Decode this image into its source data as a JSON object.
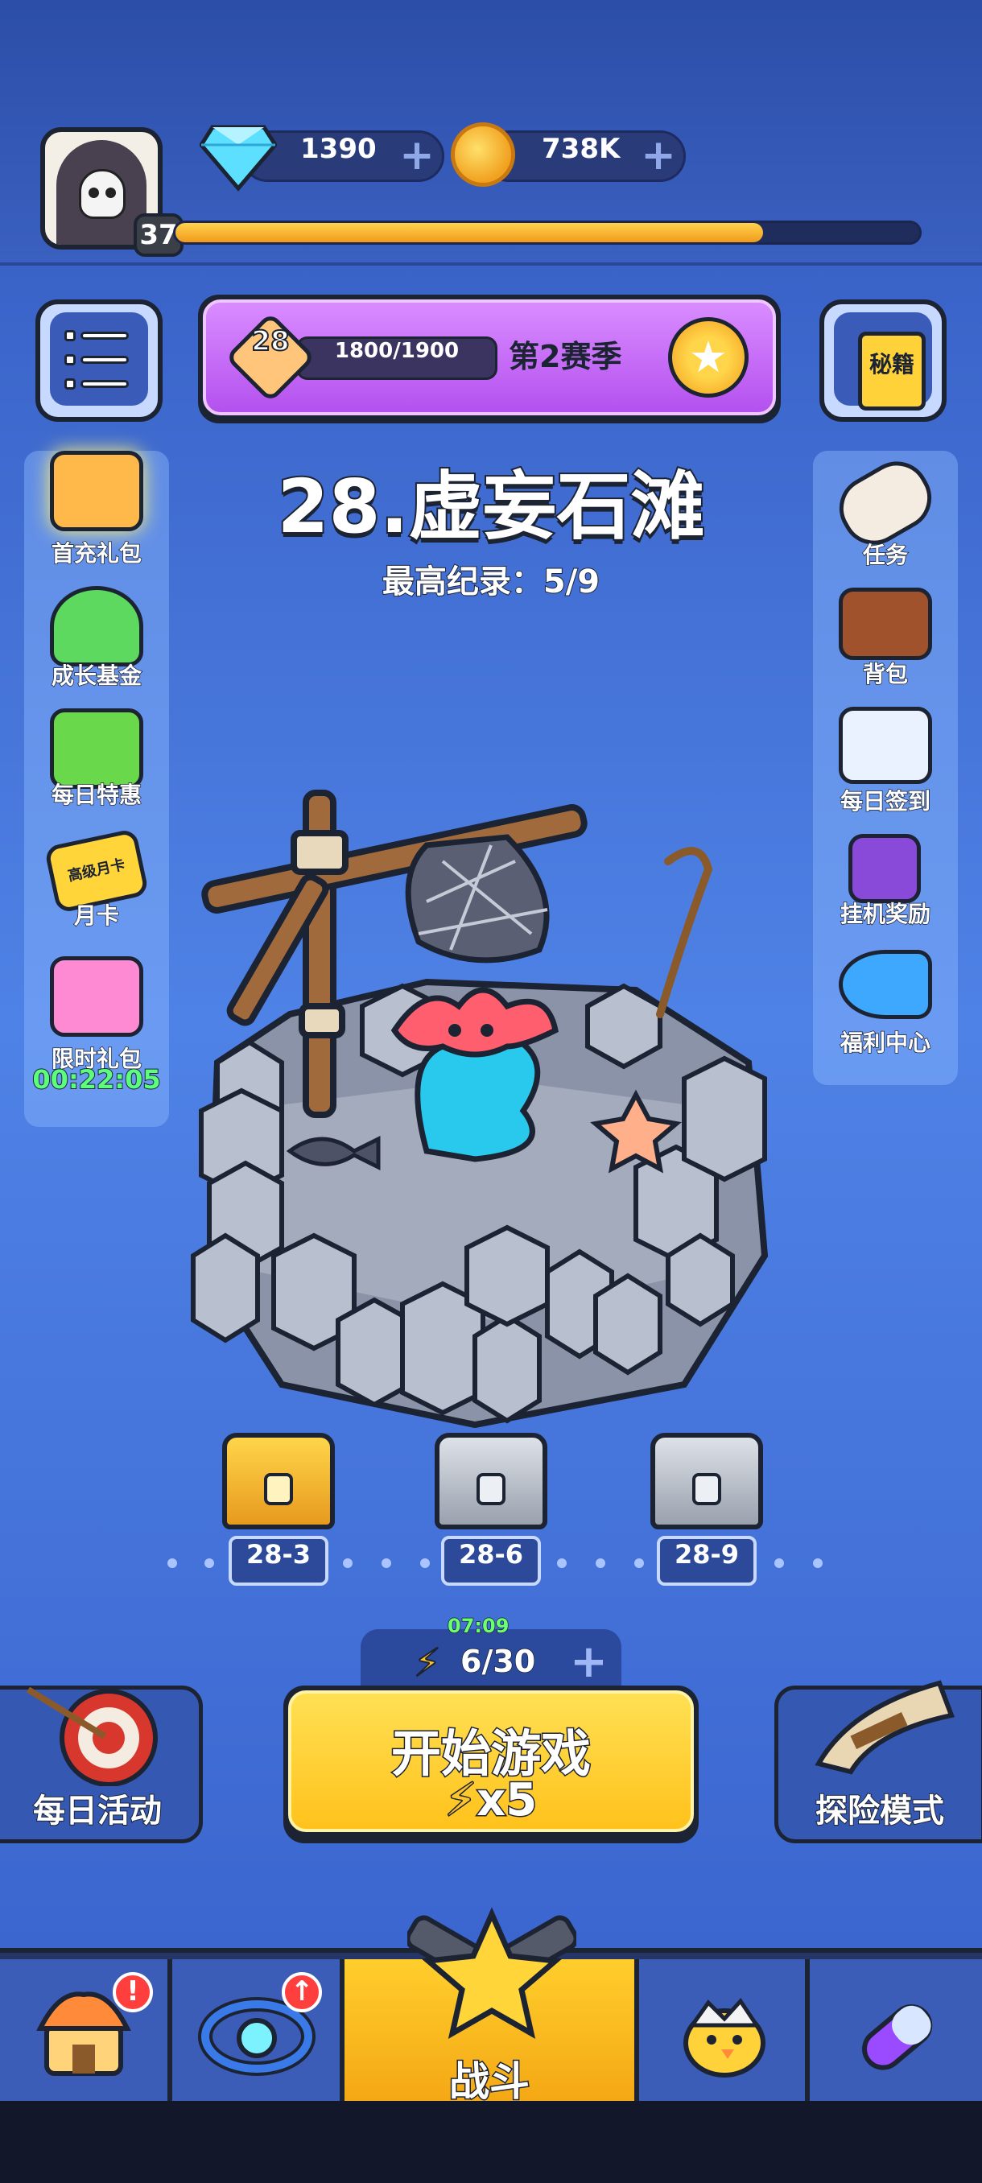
{
  "player": {
    "level": "37",
    "xp_fraction": 0.79
  },
  "currency": {
    "gems": "1390",
    "coins": "738K",
    "plus": "+"
  },
  "season": {
    "level": "28",
    "progress": "1800/1900",
    "title": "第2赛季"
  },
  "secret_button": {
    "label": "秘籍"
  },
  "stage": {
    "title": "28.虚妄石滩",
    "record": "最高纪录：5/9"
  },
  "left_side": [
    {
      "label": "首充礼包",
      "icon": "gift-chest-icon"
    },
    {
      "label": "成长基金",
      "icon": "growth-arrow-icon"
    },
    {
      "label": "每日特惠",
      "icon": "shopping-basket-icon"
    },
    {
      "label": "月卡",
      "icon": "monthly-card-icon",
      "card_text": "高级月卡"
    },
    {
      "label": "限时礼包",
      "icon": "limited-gift-icon",
      "timer": "00:22:05"
    }
  ],
  "right_side": [
    {
      "label": "任务",
      "icon": "scroll-icon"
    },
    {
      "label": "背包",
      "icon": "backpack-icon"
    },
    {
      "label": "每日签到",
      "icon": "clipboard-check-icon"
    },
    {
      "label": "挂机奖励",
      "icon": "hourglass-icon"
    },
    {
      "label": "福利中心",
      "icon": "megaphone-icon"
    }
  ],
  "chests": [
    {
      "label": "28-3",
      "state": "gold"
    },
    {
      "label": "28-6",
      "state": "locked"
    },
    {
      "label": "28-9",
      "state": "locked"
    }
  ],
  "energy": {
    "timer": "07:09",
    "value": "6/30",
    "bolt": "⚡",
    "plus": "+"
  },
  "start": {
    "label": "开始游戏",
    "cost": "x5",
    "bolt": "⚡"
  },
  "modes": {
    "left": "每日活动",
    "right": "探险模式"
  },
  "nav": {
    "battle_label": "战斗",
    "badge_alert": "!",
    "badge_up": "↑"
  },
  "colors": {
    "accent": "#ffc21c",
    "bg": "#4f82e6",
    "outline": "#1c2333"
  }
}
